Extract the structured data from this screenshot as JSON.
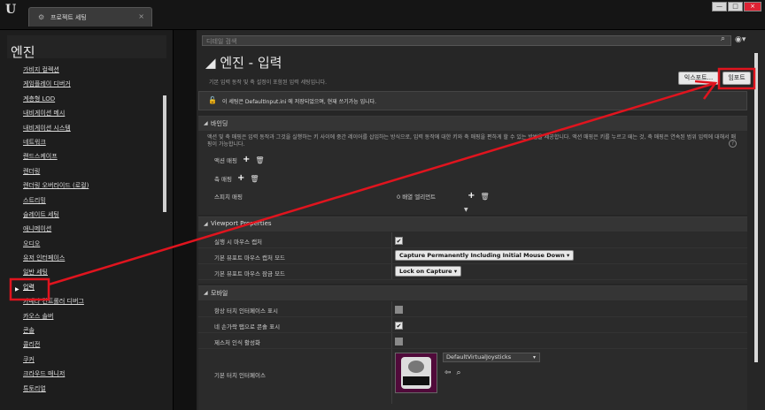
{
  "titlebar": {
    "logo": "U",
    "tab_label": "프로젝트 세팅",
    "tab_close": "×",
    "min": "—",
    "max": "□",
    "close": "×"
  },
  "left": {
    "title": "엔진",
    "items": [
      "가비지 컬렉션",
      "게임플레이 디버거",
      "계층형 LOD",
      "내비게이션 메시",
      "내비게이션 시스템",
      "네트워크",
      "랜드스케이프",
      "렌더링",
      "렌더링 오버라이드 (로컬)",
      "스트리밍",
      "슬레이트 세팅",
      "애니메이션",
      "오디오",
      "유저 인터페이스",
      "일반 세팅",
      "입력",
      "카메라 컨트롤러 디버그",
      "카오스 솔버",
      "콘솔",
      "콜리전",
      "쿠커",
      "크라우드 매니저",
      "튜토리얼"
    ],
    "selected_index": 15
  },
  "right": {
    "search_placeholder": "디테일 검색",
    "title": "엔진 - 입력",
    "description": "기본 입력 동작 및 축 설정이 포함된 입력 세팅입니다.",
    "export_label": "익스포트...",
    "import_label": "임포트",
    "notice": "이 세팅은 DefaultInput.ini 에 저장되었으며, 현재 쓰기가능 입니다.",
    "binding": {
      "header": "바인딩",
      "desc": "액션 및 축 매핑은 입력 동작과 그것을 실행하는 키 사이에 중간 레이어를 삽입하는 방식으로, 입력 동작에 대한 키와 축 매핑을 편하게 할 수 있는 방법을 제공합니다. 액션 매핑은 키를 누르고 떼는 것, 축 매핑은 연속된 범위 입력에 대해서 매핑이 가능합니다.",
      "action_mapping": "액션 매핑",
      "axis_mapping": "축 매핑",
      "speech_mapping": "스피치 매핑",
      "speech_value": "0 배열 엘리먼트"
    },
    "viewport": {
      "header": "Viewport Properties",
      "rows": [
        {
          "label": "실행 시 마우스 캡처",
          "type": "checkbox",
          "checked": true
        },
        {
          "label": "기본 뷰포트 마우스 캡처 모드",
          "type": "dropdown",
          "value": "Capture Permanently Including Initial Mouse Down"
        },
        {
          "label": "기본 뷰포트 마우스 잠금 모드",
          "type": "dropdown",
          "value": "Lock on Capture"
        }
      ]
    },
    "mobile": {
      "header": "모바일",
      "rows": [
        {
          "label": "항상 터치 인터페이스 표시",
          "checked": false
        },
        {
          "label": "네 손가락 탭으로 콘솔 표시",
          "checked": true
        },
        {
          "label": "제스처 인식 활성화",
          "checked": false
        }
      ],
      "touch_label": "기본 터치 인터페이스",
      "touch_value": "DefaultVirtualJoysticks"
    }
  },
  "colors": {
    "annotation": "#e0141e"
  }
}
